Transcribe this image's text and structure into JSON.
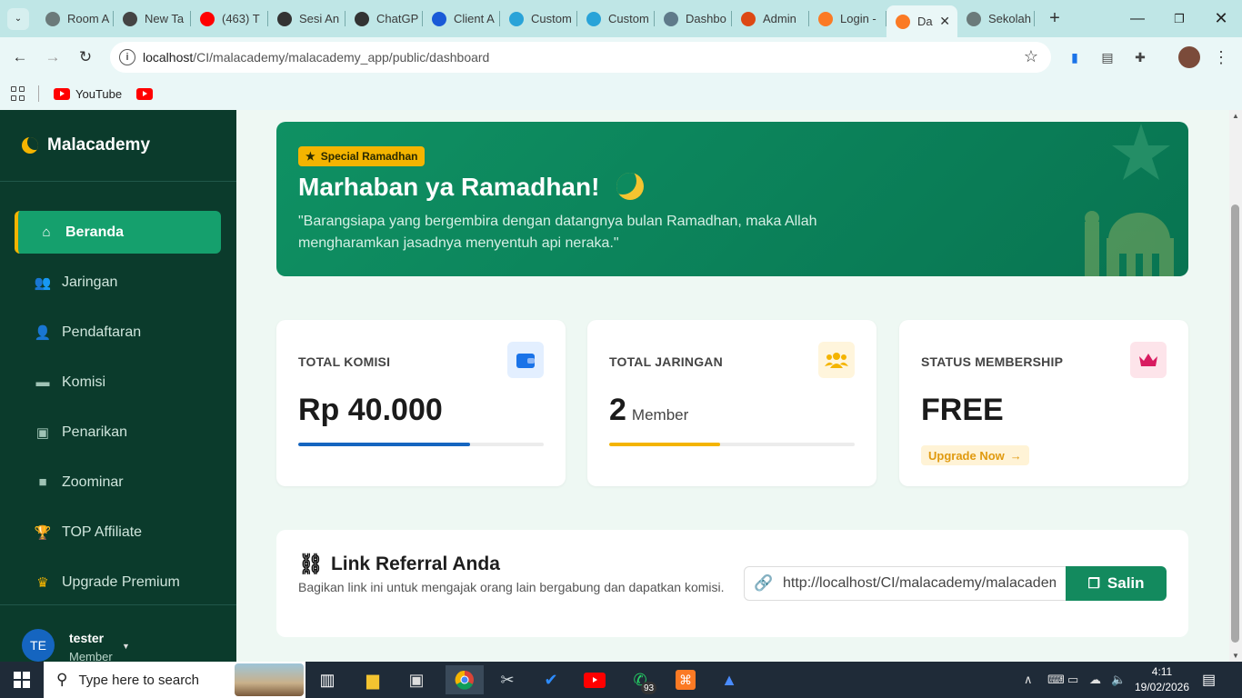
{
  "browser": {
    "tabs": [
      {
        "title": "Room A",
        "icon": "globe-icon",
        "color": "#6b7a7a"
      },
      {
        "title": "New Ta",
        "icon": "chrome-icon",
        "color": "#444444"
      },
      {
        "title": "(463) T",
        "icon": "youtube-icon",
        "color": "#ff0000"
      },
      {
        "title": "Sesi An",
        "icon": "openai-icon",
        "color": "#333333"
      },
      {
        "title": "ChatGP",
        "icon": "openai-icon",
        "color": "#333333"
      },
      {
        "title": "Client A",
        "icon": "webflow-icon",
        "color": "#1a5ad7"
      },
      {
        "title": "Custom",
        "icon": "dev-icon",
        "color": "#29a3d8"
      },
      {
        "title": "Custom",
        "icon": "dev-icon",
        "color": "#29a3d8"
      },
      {
        "title": "Dashbo",
        "icon": "dashboard-icon",
        "color": "#5f7a8a"
      },
      {
        "title": "Admin",
        "icon": "codeigniter-icon",
        "color": "#dd4814"
      },
      {
        "title": "Login -",
        "icon": "xampp-icon",
        "color": "#fb7a24"
      },
      {
        "title": "Da",
        "icon": "xampp-icon",
        "color": "#fb7a24",
        "active": true
      },
      {
        "title": "Sekolah",
        "icon": "globe-icon",
        "color": "#6b7a7a"
      }
    ],
    "url_host": "localhost",
    "url_path": "/CI/malacademy/malacademy_app/public/dashboard",
    "bookmarks": [
      {
        "label": "YouTube"
      }
    ]
  },
  "sidebar": {
    "brand": "Malacademy",
    "items": [
      {
        "label": "Beranda",
        "icon": "home-icon",
        "glyph": "⌂"
      },
      {
        "label": "Jaringan",
        "icon": "users-icon",
        "glyph": "👥"
      },
      {
        "label": "Pendaftaran",
        "icon": "user-plus-icon",
        "glyph": "👤"
      },
      {
        "label": "Komisi",
        "icon": "wallet-icon",
        "glyph": "▬"
      },
      {
        "label": "Penarikan",
        "icon": "money-icon",
        "glyph": "▣"
      },
      {
        "label": "Zoominar",
        "icon": "video-icon",
        "glyph": "■"
      },
      {
        "label": "TOP Affiliate",
        "icon": "trophy-icon",
        "glyph": "🏆"
      },
      {
        "label": "Upgrade Premium",
        "icon": "crown-icon",
        "glyph": "♛"
      }
    ],
    "user": {
      "initials": "TE",
      "name": "tester",
      "role": "Member"
    }
  },
  "hero": {
    "badge": "Special Ramadhan",
    "title": "Marhaban ya Ramadhan!",
    "quote": "\"Barangsiapa yang bergembira dengan datangnya bulan Ramadhan, maka Allah mengharamkan jasadnya menyentuh api neraka.\""
  },
  "stats": {
    "komisi": {
      "label": "TOTAL KOMISI",
      "value": "Rp 40.000",
      "progress": 0.7,
      "color": "#1565c0",
      "icon": "wallet-icon"
    },
    "jaringan": {
      "label": "TOTAL JARINGAN",
      "value": "2",
      "unit": "Member",
      "progress": 0.45,
      "color": "#f4b400",
      "icon": "users-icon"
    },
    "membership": {
      "label": "STATUS MEMBERSHIP",
      "value": "FREE",
      "cta": "Upgrade Now",
      "icon": "crown-icon",
      "color": "#d81b60"
    }
  },
  "referral": {
    "title": "Link Referral Anda",
    "description": "Bagikan link ini untuk mengajak orang lain bergabung dan dapatkan komisi.",
    "link": "http://localhost/CI/malacademy/malacademy_app/public/register?ref=tester",
    "copy_label": "Salin"
  },
  "taskbar": {
    "search_placeholder": "Type here to search",
    "whatsapp_badge": "93",
    "time": "4:11",
    "date": "19/02/2026"
  }
}
